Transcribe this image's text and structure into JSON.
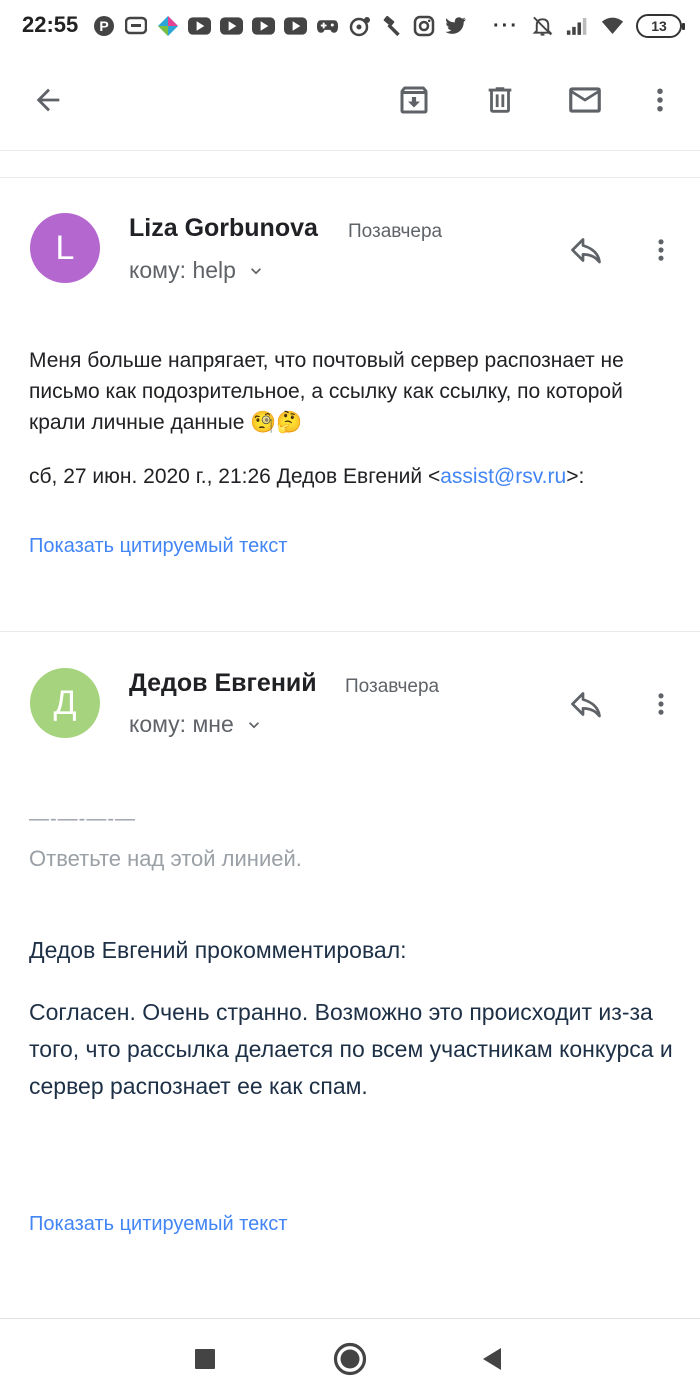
{
  "status_bar": {
    "time": "22:55",
    "battery": "13",
    "left_icons": [
      "pinterest-icon",
      "chat-icon",
      "app-icon",
      "youtube-icon",
      "youtube-icon",
      "youtube-icon",
      "youtube-icon",
      "gamepad-icon",
      "vinyl-icon",
      "hammer-icon",
      "instagram-icon",
      "twitter-icon"
    ],
    "more": "···"
  },
  "toolbar": {
    "back_icon": "arrow-back-icon",
    "archive_icon": "archive-icon",
    "delete_icon": "trash-icon",
    "mark_unread_icon": "mail-icon",
    "more_icon": "more-vert-icon"
  },
  "messages": [
    {
      "avatar_letter": "L",
      "avatar_color": "#b367cf",
      "sender": "Liza Gorbunova",
      "date": "Позавчера",
      "recipient": "кому: help",
      "body": "Меня больше напрягает, что почтовый сервер распознает не письмо как подозрительное, а ссылку как ссылку, по которой крали личные данные 🧐🤔",
      "quote_header_prefix": "сб, 27 июн. 2020 г., 21:26 Дедов Евгений <",
      "quote_header_email": "assist@rsv.ru",
      "quote_header_suffix": ">:",
      "show_quoted": "Показать цитируемый текст"
    },
    {
      "avatar_letter": "Д",
      "avatar_color": "#a5d37e",
      "sender": "Дедов Евгений",
      "date": "Позавчера",
      "recipient": "кому: мне",
      "reply_line": "—-—-—-—",
      "reply_hint": "Ответьте над этой линией.",
      "commented": "Дедов Евгений прокомментировал:",
      "comment": "Согласен. Очень странно. Возможно это происходит из-за того, что рассылка делается по всем участникам конкурса и сервер распознает ее как спам.",
      "show_quoted": "Показать цитируемый текст"
    }
  ],
  "nav_bar": {
    "recents_icon": "square-icon",
    "home_icon": "circle-icon",
    "back_icon": "triangle-back-icon"
  }
}
